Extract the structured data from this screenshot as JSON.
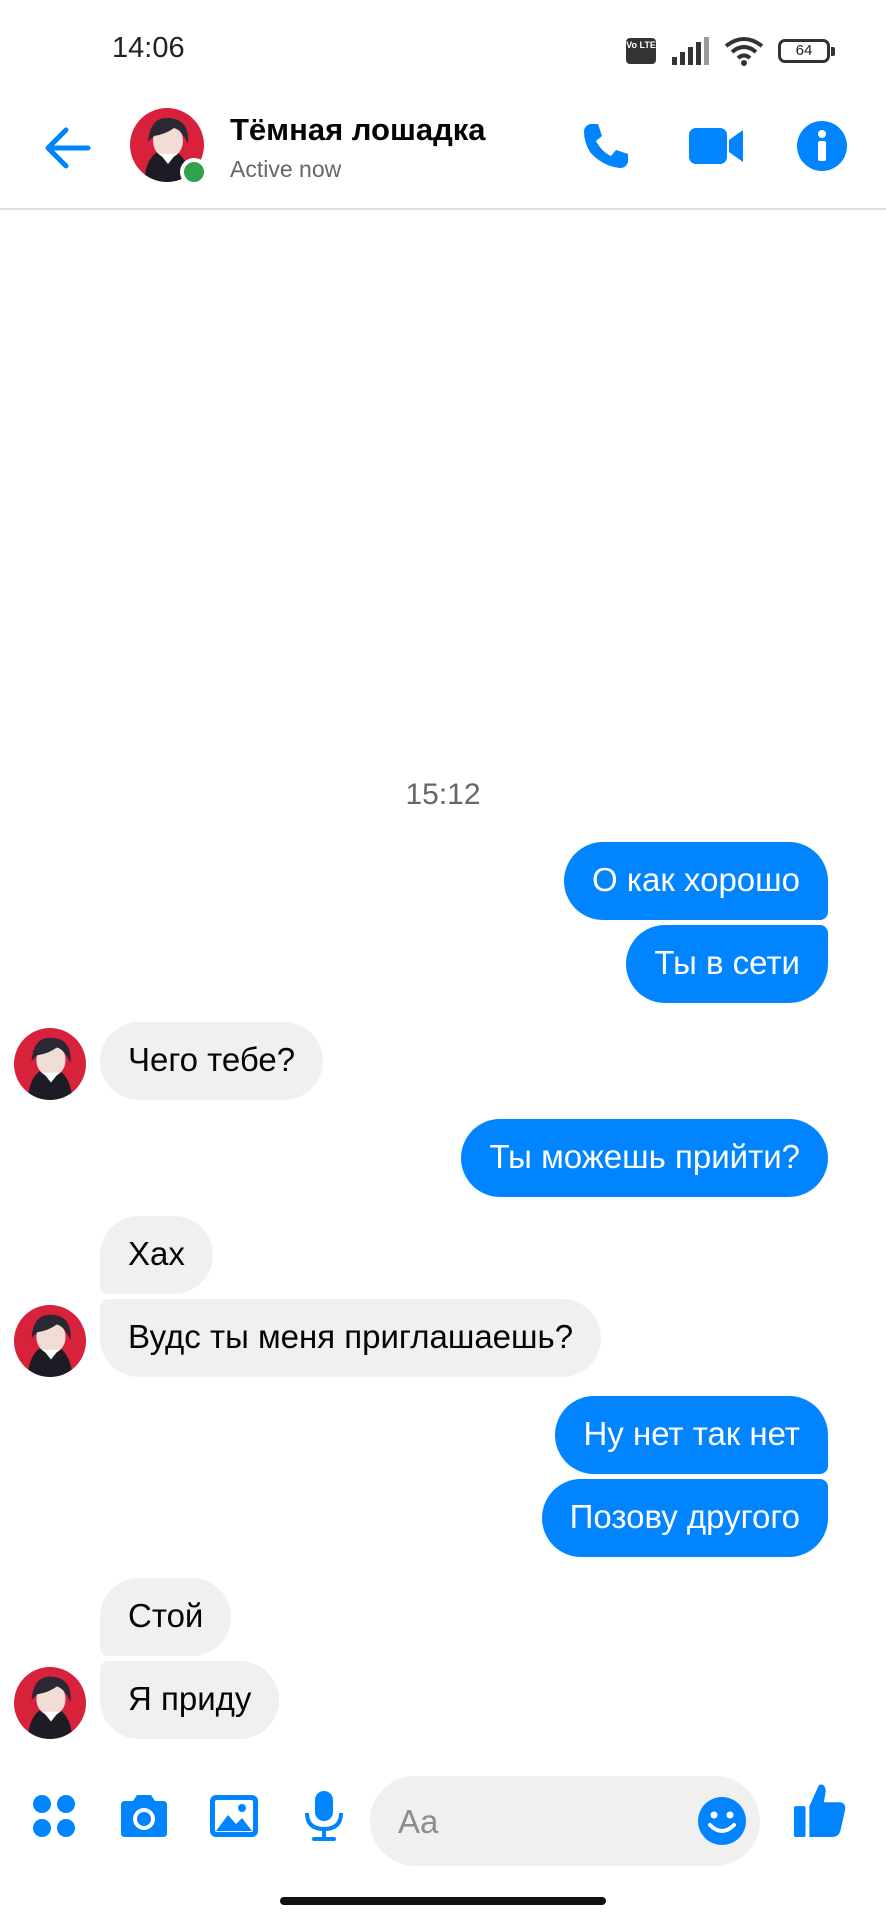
{
  "status_bar": {
    "time": "14:06",
    "volte": "Vo LTE",
    "battery": "64",
    "icons": [
      "volte-icon",
      "signal-icon",
      "wifi-icon",
      "battery-icon"
    ]
  },
  "header": {
    "contact_name": "Тёмная лошадка",
    "status": "Active now",
    "icons": [
      "back-arrow-icon",
      "phone-icon",
      "video-camera-icon",
      "info-icon"
    ]
  },
  "conversation": {
    "timestamp": "15:12",
    "messages": [
      {
        "side": "out",
        "text": "О как хорошо"
      },
      {
        "side": "out",
        "text": "Ты в сети"
      },
      {
        "side": "in",
        "text": "Чего тебе?"
      },
      {
        "side": "out",
        "text": "Ты можешь прийти?"
      },
      {
        "side": "in",
        "text": "Хах"
      },
      {
        "side": "in",
        "text": "Вудс ты меня приглашаешь?"
      },
      {
        "side": "out",
        "text": "Ну нет так нет"
      },
      {
        "side": "out",
        "text": "Позову другого"
      },
      {
        "side": "in",
        "text": "Стой"
      },
      {
        "side": "in",
        "text": "Я приду"
      }
    ]
  },
  "composer": {
    "placeholder": "Aa",
    "value": "",
    "icons": [
      "apps-menu-icon",
      "camera-icon",
      "gallery-icon",
      "microphone-icon",
      "emoji-icon",
      "thumbs-up-icon"
    ]
  },
  "colors": {
    "accent": "#0084ff",
    "incoming_bubble": "#f0f0f0",
    "online": "#31a24c",
    "avatar_bg": "#d8213a"
  }
}
